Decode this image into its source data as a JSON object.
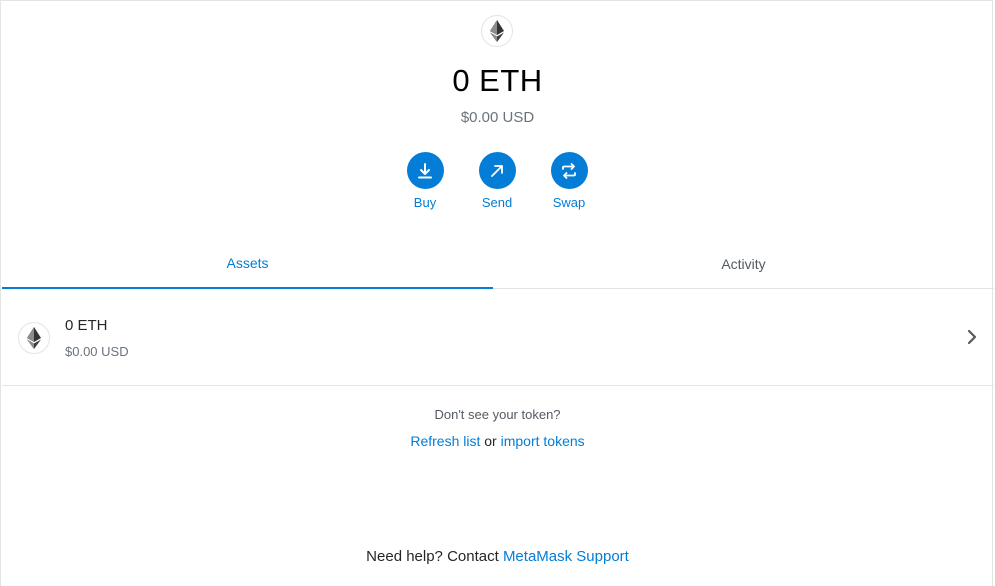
{
  "balance": {
    "primary": "0 ETH",
    "secondary": "$0.00 USD",
    "logo_icon": "ethereum-icon"
  },
  "actions": [
    {
      "label": "Buy",
      "icon": "download-arrow-icon"
    },
    {
      "label": "Send",
      "icon": "arrow-up-right-icon"
    },
    {
      "label": "Swap",
      "icon": "swap-arrows-icon"
    }
  ],
  "tabs": {
    "assets": "Assets",
    "activity": "Activity",
    "active": "assets"
  },
  "asset_list": [
    {
      "primary": "0 ETH",
      "secondary": "$0.00 USD",
      "icon": "ethereum-icon"
    }
  ],
  "token_help": {
    "question": "Don't see your token?",
    "refresh_link": "Refresh list",
    "or_text": "or",
    "import_link": "import tokens"
  },
  "support": {
    "prefix": "Need help? Contact",
    "link": "MetaMask Support"
  },
  "colors": {
    "accent": "#037dd6",
    "muted_text": "#6a737d",
    "border": "#e4e4e4"
  }
}
